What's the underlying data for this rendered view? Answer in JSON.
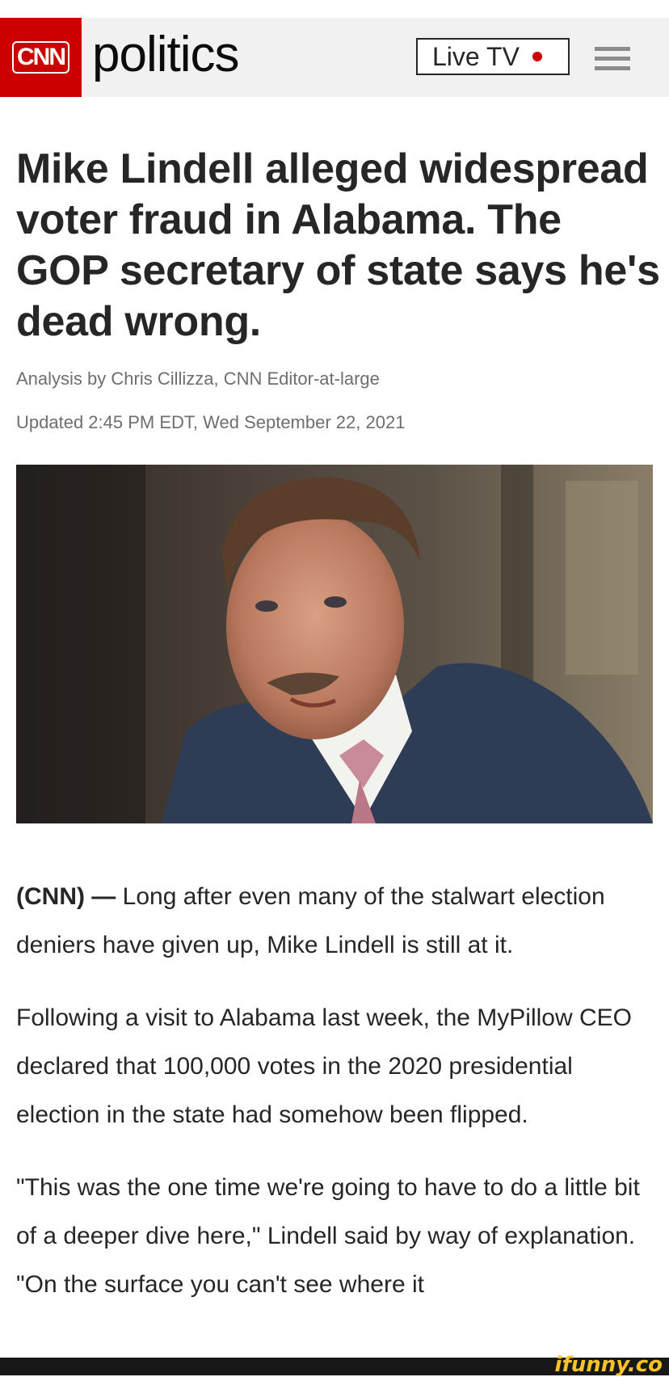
{
  "header": {
    "logo_text": "CNN",
    "section_name": "politics",
    "live_tv_label": "Live TV",
    "live_dot_color": "#cc0000",
    "menu_icon": "hamburger-menu-icon"
  },
  "article": {
    "headline": "Mike Lindell alleged widespread voter fraud in Alabama. The GOP secretary of state says he's dead wrong.",
    "byline": "Analysis by Chris Cillizza, CNN Editor-at-large",
    "timestamp": "Updated 2:45 PM EDT, Wed September 22, 2021",
    "paragraphs": [
      {
        "source": "(CNN) —",
        "text": " Long after even many of the stalwart election deniers have given up, Mike Lindell is still at it."
      },
      {
        "text": "Following a visit to Alabama last week, the MyPillow CEO declared that 100,000 votes in the 2020 presidential election in the state had somehow been flipped."
      },
      {
        "text": "\"This was the one time we're going to have to do a little bit of a deeper dive here,\" Lindell said by way of explanation. \"On the surface you can't see where it"
      }
    ]
  },
  "watermark": "ifunny.co",
  "colors": {
    "brand_red": "#cc0000",
    "text": "#262626",
    "meta": "#6e6e6e",
    "header_bg": "#f1f1f1"
  }
}
